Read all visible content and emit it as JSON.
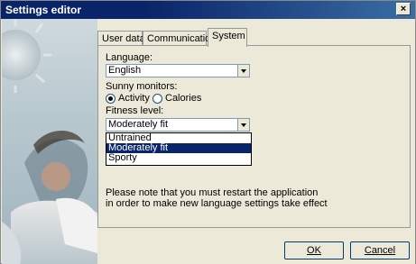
{
  "window": {
    "title": "Settings editor",
    "close_label": "×"
  },
  "tabs": [
    {
      "label": "User data"
    },
    {
      "label": "Communication"
    },
    {
      "label": "System"
    }
  ],
  "system": {
    "language_label": "Language:",
    "language_value": "English",
    "sunny_label": "Sunny monitors:",
    "radio_activity": "Activity",
    "radio_calories": "Calories",
    "selected_radio": "Activity",
    "fitness_label": "Fitness level:",
    "fitness_value": "Moderately fit",
    "fitness_options": [
      "Untrained",
      "Moderately fit",
      "Sporty"
    ],
    "note_line1": "Please note that you must restart the application",
    "note_line2": "in order to make new language settings take effect"
  },
  "buttons": {
    "ok_label": "OK",
    "cancel_label": "Cancel"
  },
  "colors": {
    "title_bar": "#0a246a",
    "selected_item": "#0a246a"
  },
  "icons": {
    "left_panel": "sun-and-person-illustration"
  }
}
